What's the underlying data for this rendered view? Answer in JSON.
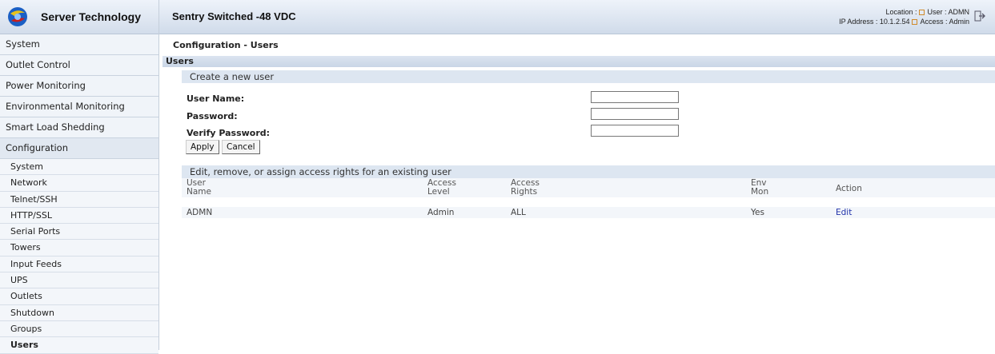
{
  "brand": {
    "name": "Server Technology"
  },
  "header": {
    "title": "Sentry Switched -48 VDC",
    "location_label": "Location :",
    "user_label": "User : ADMN",
    "ip_label": "IP Address : 10.1.2.54",
    "access_label": "Access : Admin"
  },
  "sidebar": {
    "main_items": [
      {
        "label": "System"
      },
      {
        "label": "Outlet Control"
      },
      {
        "label": "Power Monitoring"
      },
      {
        "label": "Environmental Monitoring"
      },
      {
        "label": "Smart Load Shedding"
      },
      {
        "label": "Configuration"
      }
    ],
    "sub_items": [
      {
        "label": "System"
      },
      {
        "label": "Network"
      },
      {
        "label": "Telnet/SSH"
      },
      {
        "label": "HTTP/SSL"
      },
      {
        "label": "Serial Ports"
      },
      {
        "label": "Towers"
      },
      {
        "label": "Input Feeds"
      },
      {
        "label": "UPS"
      },
      {
        "label": "Outlets"
      },
      {
        "label": "Shutdown"
      },
      {
        "label": "Groups"
      },
      {
        "label": "Users"
      }
    ]
  },
  "page": {
    "title": "Configuration - Users",
    "section": "Users",
    "create": {
      "heading": "Create a new user",
      "username_label": "User Name:",
      "password_label": "Password:",
      "verify_label": "Verify Password:",
      "username_value": "",
      "password_value": "",
      "verify_value": "",
      "apply_label": "Apply",
      "cancel_label": "Cancel"
    },
    "users": {
      "heading": "Edit, remove, or assign access rights for an existing user",
      "columns": [
        {
          "line1": "User",
          "line2": "Name"
        },
        {
          "line1": "Access",
          "line2": "Level"
        },
        {
          "line1": "Access",
          "line2": "Rights"
        },
        {
          "line1": "Env",
          "line2": "Mon"
        },
        {
          "line1": "Action",
          "line2": ""
        }
      ],
      "rows": [
        {
          "name": "ADMN",
          "level": "Admin",
          "rights": "ALL",
          "env": "Yes",
          "action": "Edit"
        }
      ]
    }
  }
}
